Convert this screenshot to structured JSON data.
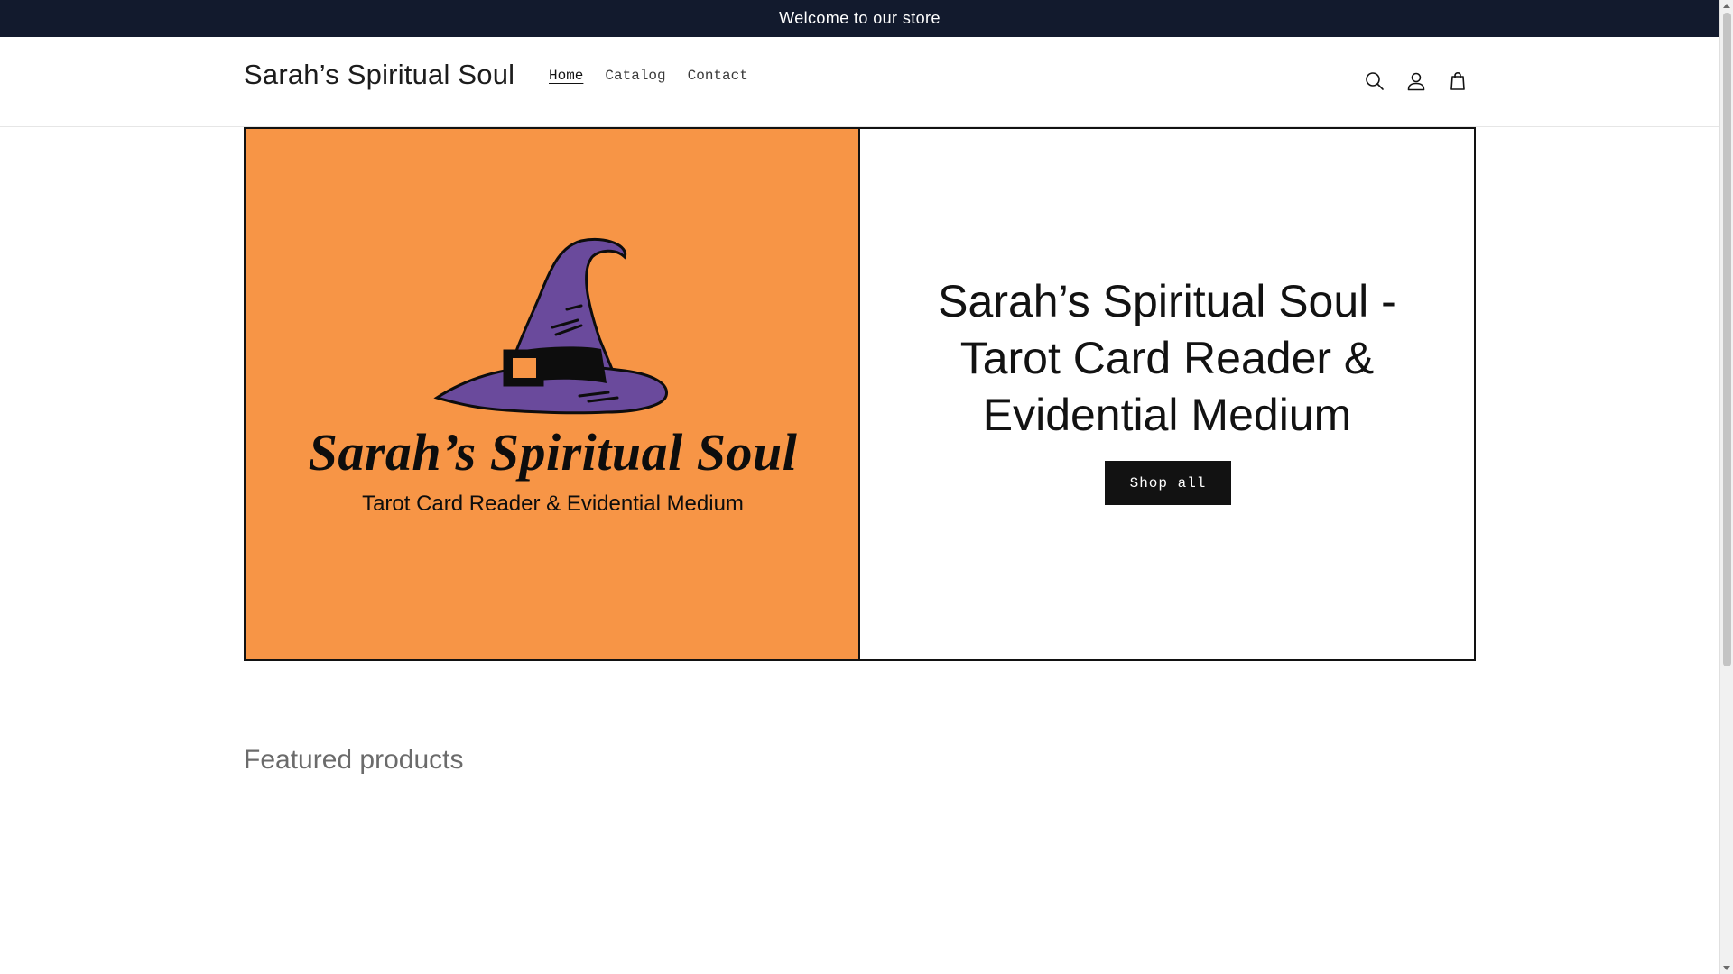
{
  "announcement": {
    "text": "Welcome to our store"
  },
  "header": {
    "brand": "Sarah’s Spiritual Soul",
    "nav": [
      {
        "label": "Home",
        "active": true
      },
      {
        "label": "Catalog",
        "active": false
      },
      {
        "label": "Contact",
        "active": false
      }
    ],
    "icons": [
      "search-icon",
      "account-icon",
      "cart-icon"
    ]
  },
  "hero": {
    "logo": {
      "script_text": "Sarah’s Spiritual Soul",
      "tagline": "Tarot Card Reader & Evidential Medium",
      "background_color": "#f79546",
      "hat_color": "#6a4a9c"
    },
    "title": "Sarah’s Spiritual Soul - Tarot Card Reader & Evidential Medium",
    "button_label": "Shop all"
  },
  "featured": {
    "title": "Featured products"
  },
  "colors": {
    "announcement_bg": "#121a2d",
    "text": "#121212",
    "muted": "#6b6b6b"
  }
}
